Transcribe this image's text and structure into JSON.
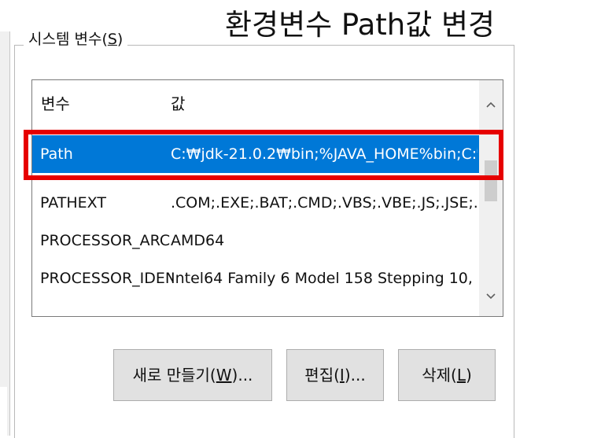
{
  "headline": "환경변수 Path값 변경",
  "group": {
    "label_prefix": "시스템 변수(",
    "label_accel": "S",
    "label_suffix": ")"
  },
  "table": {
    "columns": [
      "변수",
      "값"
    ],
    "rows": [
      {
        "variable": "Path",
        "value": "C:₩jdk-21.0.2₩bin;%JAVA_HOME%bin;C:₩...",
        "selected": true
      },
      {
        "variable": "PATHEXT",
        "value": ".COM;.EXE;.BAT;.CMD;.VBS;.VBE;.JS;.JSE;.W..."
      },
      {
        "variable": "PROCESSOR_ARC...",
        "value": "AMD64"
      },
      {
        "variable": "PROCESSOR_IDEN...",
        "value": "Intel64 Family 6 Model 158 Stepping 10, ..."
      }
    ]
  },
  "scrollbar": {
    "up_icon": "chevron-up-icon",
    "down_icon": "chevron-down-icon"
  },
  "buttons": {
    "new": {
      "prefix": "새로 만들기(",
      "accel": "W",
      "suffix": ")..."
    },
    "edit": {
      "prefix": "편집(",
      "accel": "I",
      "suffix": ")..."
    },
    "delete": {
      "prefix": "삭제(",
      "accel": "L",
      "suffix": ")"
    }
  },
  "colors": {
    "selection": "#0078d7",
    "highlight": "#e60000"
  }
}
